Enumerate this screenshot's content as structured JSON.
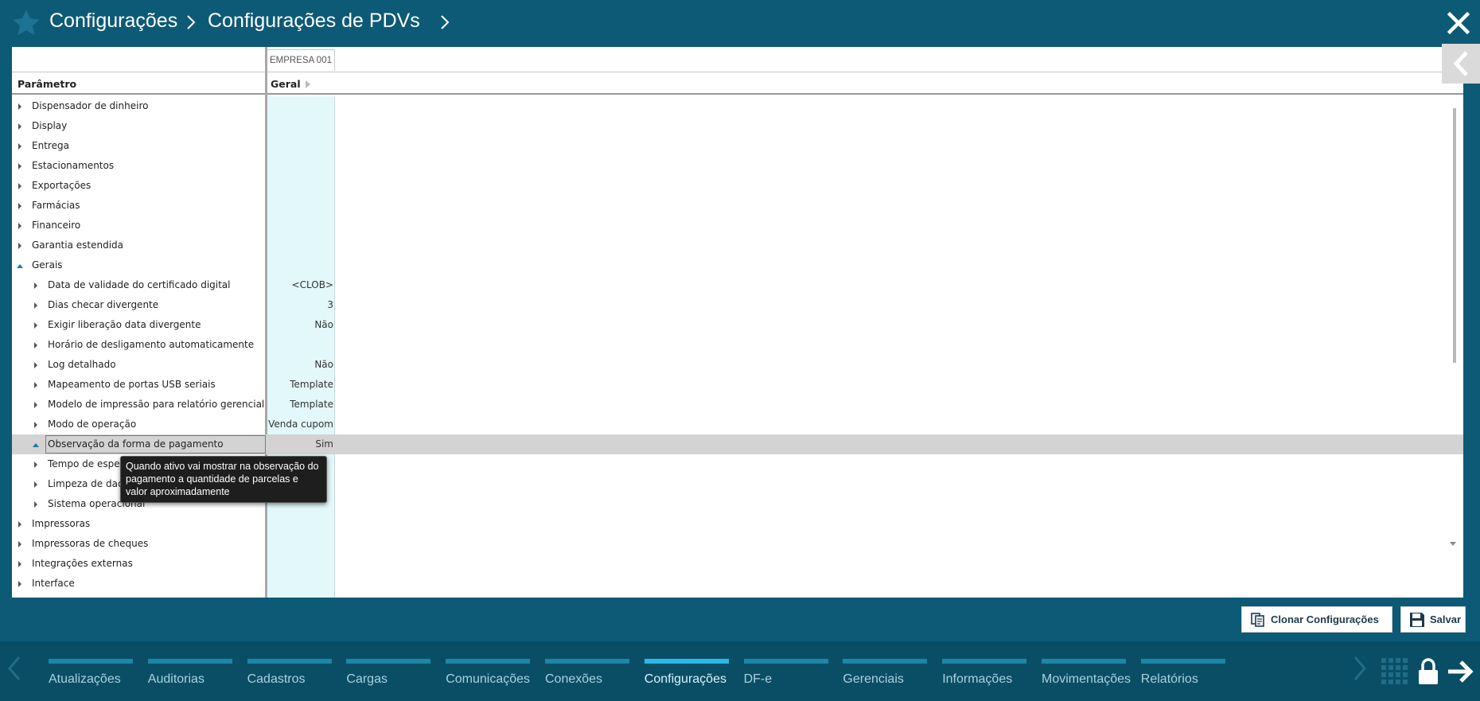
{
  "header": {
    "crumb1": "Configurações",
    "crumb2": "Configurações de PDVs"
  },
  "grid": {
    "company_column": "EMPRESA 001",
    "param_header": "Parâmetro",
    "geral_header": "Geral",
    "rows": [
      {
        "label": "Dispensador de dinheiro",
        "value": "",
        "level": 0,
        "open": false
      },
      {
        "label": "Display",
        "value": "",
        "level": 0,
        "open": false
      },
      {
        "label": "Entrega",
        "value": "",
        "level": 0,
        "open": false
      },
      {
        "label": "Estacionamentos",
        "value": "",
        "level": 0,
        "open": false
      },
      {
        "label": "Exportações",
        "value": "",
        "level": 0,
        "open": false
      },
      {
        "label": "Farmácias",
        "value": "",
        "level": 0,
        "open": false
      },
      {
        "label": "Financeiro",
        "value": "",
        "level": 0,
        "open": false
      },
      {
        "label": "Garantia estendida",
        "value": "",
        "level": 0,
        "open": false
      },
      {
        "label": "Gerais",
        "value": "",
        "level": 0,
        "open": true
      },
      {
        "label": "Data de validade do certificado digital",
        "value": "<CLOB>",
        "level": 1,
        "open": false
      },
      {
        "label": "Dias checar divergente",
        "value": "3",
        "level": 1,
        "open": false
      },
      {
        "label": "Exigir liberação data divergente",
        "value": "Não",
        "level": 1,
        "open": false
      },
      {
        "label": "Horário de desligamento automaticamente",
        "value": "",
        "level": 1,
        "open": false
      },
      {
        "label": "Log detalhado",
        "value": "Não",
        "level": 1,
        "open": false
      },
      {
        "label": "Mapeamento de portas USB seriais",
        "value": "Template",
        "level": 1,
        "open": false
      },
      {
        "label": "Modelo de impressão para relatório gerencial",
        "value": "Template",
        "level": 1,
        "open": false
      },
      {
        "label": "Modo de operação",
        "value": "Venda cupom",
        "level": 1,
        "open": false
      },
      {
        "label": "Observação da forma de pagamento",
        "value": "Sim",
        "level": 1,
        "open": true,
        "selected": true
      },
      {
        "label": "Tempo de espera",
        "value": "",
        "level": 1,
        "open": false
      },
      {
        "label": "Limpeza de dados",
        "value": "",
        "level": 1,
        "open": false
      },
      {
        "label": "Sistema operacional",
        "value": "",
        "level": 1,
        "open": false
      },
      {
        "label": "Impressoras",
        "value": "",
        "level": 0,
        "open": false
      },
      {
        "label": "Impressoras de cheques",
        "value": "",
        "level": 0,
        "open": false
      },
      {
        "label": "Integrações externas",
        "value": "",
        "level": 0,
        "open": false
      },
      {
        "label": "Interface",
        "value": "",
        "level": 0,
        "open": false
      }
    ]
  },
  "tooltip": {
    "text": "Quando ativo vai mostrar na observação do pagamento a quantidade de parcelas e valor aproximadamente"
  },
  "actions": {
    "clone_label": "Clonar Configurações",
    "save_label": "Salvar"
  },
  "nav": {
    "items": [
      {
        "label": "Atualizações",
        "active": false
      },
      {
        "label": "Auditorias",
        "active": false
      },
      {
        "label": "Cadastros",
        "active": false
      },
      {
        "label": "Cargas",
        "active": false
      },
      {
        "label": "Comunicações",
        "active": false
      },
      {
        "label": "Conexões",
        "active": false
      },
      {
        "label": "Configurações",
        "active": true
      },
      {
        "label": "DF-e",
        "active": false
      },
      {
        "label": "Gerenciais",
        "active": false
      },
      {
        "label": "Informações",
        "active": false
      },
      {
        "label": "Movimentações",
        "active": false
      },
      {
        "label": "Relatórios",
        "active": false
      }
    ]
  },
  "colors": {
    "header_bg": "#0d5a76",
    "nav_bg": "#0a4e66",
    "nav_bar": "#1d86a6",
    "nav_bar_active": "#29b9e6",
    "value_column_bg": "#e2f8fa",
    "selected_row": "#d3d3d3",
    "tooltip_bg": "#1e1e1e"
  },
  "icons": [
    "star-icon",
    "chevron-right-icon",
    "close-icon",
    "collapse-panel-icon",
    "clone-icon",
    "save-icon",
    "chevron-left-icon",
    "grid-icon",
    "lock-icon",
    "logout-arrow-icon"
  ]
}
